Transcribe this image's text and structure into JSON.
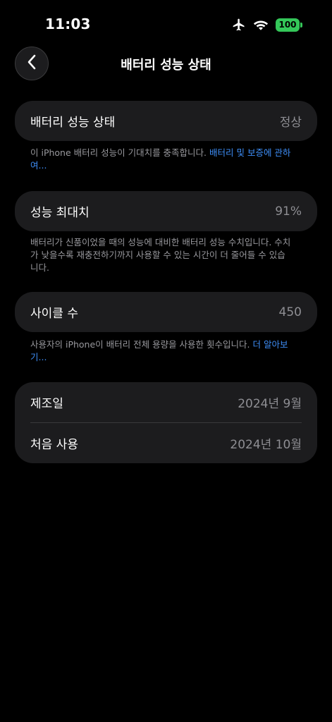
{
  "status_bar": {
    "time": "11:03",
    "battery_level": "100",
    "battery_color": "#34c759"
  },
  "nav": {
    "title": "배터리 성능 상태"
  },
  "battery_health": {
    "label": "배터리 성능 상태",
    "value": "정상",
    "footnote": "이 iPhone 배터리 성능이 기대치를 충족합니다. ",
    "link": "배터리 및 보증에 관하여..."
  },
  "max_capacity": {
    "label": "성능 최대치",
    "value": "91%",
    "footnote": "배터리가 신품이었을 때의 성능에 대비한 배터리 성능 수치입니다. 수치가 낮을수록 재충전하기까지 사용할 수 있는 시간이 더 줄어들 수 있습니다."
  },
  "cycle_count": {
    "label": "사이클 수",
    "value": "450",
    "footnote": "사용자의 iPhone이 배터리 전체 용량을 사용한 횟수입니다. ",
    "link": "더 알아보기..."
  },
  "dates": {
    "manufacture_label": "제조일",
    "manufacture_value": "2024년 9월",
    "first_use_label": "처음 사용",
    "first_use_value": "2024년 10월"
  },
  "colors": {
    "accent_link": "#3e8ef7",
    "card_bg": "#1c1c1e"
  }
}
